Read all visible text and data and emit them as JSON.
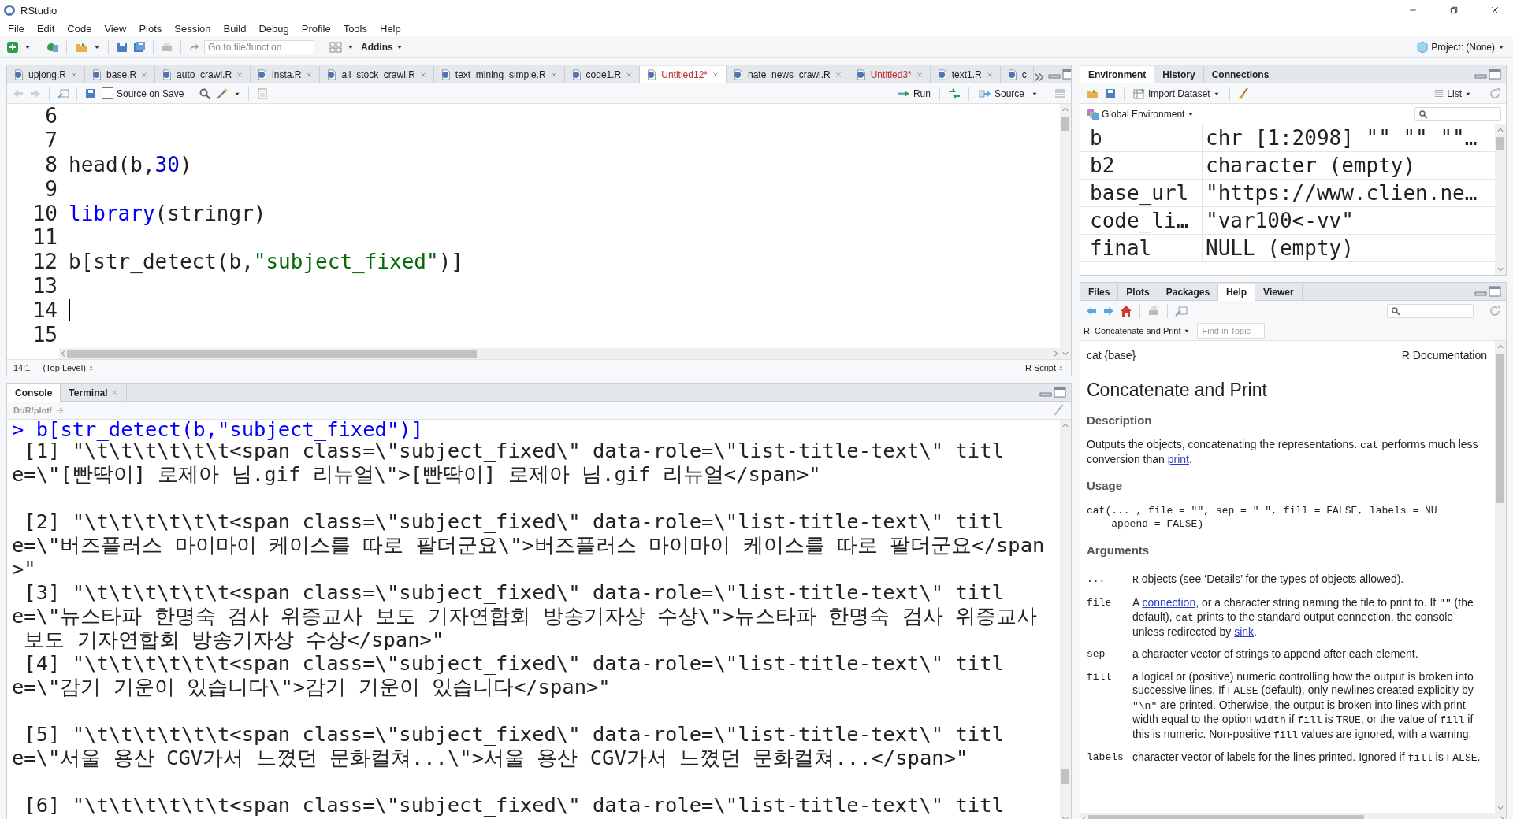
{
  "window": {
    "title": "RStudio"
  },
  "menu": [
    "File",
    "Edit",
    "Code",
    "View",
    "Plots",
    "Session",
    "Build",
    "Debug",
    "Profile",
    "Tools",
    "Help"
  ],
  "toolbar": {
    "goto_placeholder": "Go to file/function",
    "addins": "Addins",
    "project": "Project: (None)"
  },
  "editor": {
    "tabs": [
      {
        "label": "upjong.R",
        "selected": false,
        "modified": false
      },
      {
        "label": "base.R",
        "selected": false,
        "modified": false
      },
      {
        "label": "auto_crawl.R",
        "selected": false,
        "modified": false
      },
      {
        "label": "insta.R",
        "selected": false,
        "modified": false
      },
      {
        "label": "all_stock_crawl.R",
        "selected": false,
        "modified": false
      },
      {
        "label": "text_mining_simple.R",
        "selected": false,
        "modified": false
      },
      {
        "label": "code1.R",
        "selected": false,
        "modified": false
      },
      {
        "label": "Untitled12*",
        "selected": true,
        "modified": true
      },
      {
        "label": "nate_news_crawl.R",
        "selected": false,
        "modified": false
      },
      {
        "label": "Untitled3*",
        "selected": false,
        "modified": true
      },
      {
        "label": "text1.R",
        "selected": false,
        "modified": false
      },
      {
        "label": "c",
        "selected": false,
        "modified": false
      }
    ],
    "source_on_save": {
      "label": "Source on Save",
      "checked": false
    },
    "run": "Run",
    "source": "Source",
    "lines": [
      {
        "number": "6",
        "cursor": false
      },
      {
        "number": "7",
        "cursor": false
      },
      {
        "number": "8",
        "cursor": false,
        "tokens": [
          {
            "text": "head(b,",
            "kind": "plain"
          },
          {
            "text": "30",
            "kind": "number"
          },
          {
            "text": ")",
            "kind": "plain"
          }
        ]
      },
      {
        "number": "9",
        "cursor": false
      },
      {
        "number": "10",
        "cursor": false,
        "tokens": [
          {
            "text": "library",
            "kind": "keyword"
          },
          {
            "text": "(stringr)",
            "kind": "plain"
          }
        ]
      },
      {
        "number": "11",
        "cursor": false
      },
      {
        "number": "12",
        "cursor": false,
        "tokens": [
          {
            "text": "b[str_detect(b,",
            "kind": "plain"
          },
          {
            "text": "\"subject_fixed\"",
            "kind": "string"
          },
          {
            "text": ")]",
            "kind": "plain"
          }
        ]
      },
      {
        "number": "13",
        "cursor": false
      },
      {
        "number": "14",
        "cursor": true
      },
      {
        "number": "15",
        "cursor": false
      }
    ],
    "status": {
      "position": "14:1",
      "scope": "(Top Level)",
      "file_type": "R Script"
    }
  },
  "console": {
    "tabs": [
      {
        "label": "Console",
        "selected": true,
        "closable": false
      },
      {
        "label": "Terminal",
        "selected": false,
        "closable": true
      }
    ],
    "path": "D:/R/plot/",
    "command": "> b[str_detect(b,\"subject_fixed\")]",
    "output": [
      {
        "text": " [1] \"\\t\\t\\t\\t\\t\\t<span class=\\\"subject_fixed\\\" data-role=\\\"list-title-text\\\" titl",
        "space_before": false
      },
      {
        "text": "e=\\\"[빤딱이] 로제아 님.gif 리뉴얼\\\">[빤딱이] 로제아 님.gif 리뉴얼</span>\"",
        "space_before": false
      },
      {
        "text": " [2] \"\\t\\t\\t\\t\\t\\t<span class=\\\"subject_fixed\\\" data-role=\\\"list-title-text\\\" titl",
        "space_before": true
      },
      {
        "text": "e=\\\"버즈플러스 마이마이 케이스를 따로 팔더군요\\\">버즈플러스 마이마이 케이스를 따로 팔더군요</span",
        "space_before": false
      },
      {
        "text": ">\"",
        "space_before": false
      },
      {
        "text": " [3] \"\\t\\t\\t\\t\\t\\t<span class=\\\"subject_fixed\\\" data-role=\\\"list-title-text\\\" titl",
        "space_before": false
      },
      {
        "text": "e=\\\"뉴스타파 한명숙 검사 위증교사 보도 기자연합회 방송기자상 수상\\\">뉴스타파 한명숙 검사 위증교사",
        "space_before": false
      },
      {
        "text": " 보도 기자연합회 방송기자상 수상</span>\"",
        "space_before": false
      },
      {
        "text": " [4] \"\\t\\t\\t\\t\\t\\t<span class=\\\"subject_fixed\\\" data-role=\\\"list-title-text\\\" titl",
        "space_before": false
      },
      {
        "text": "e=\\\"감기 기운이 있습니다\\\">감기 기운이 있습니다</span>\"",
        "space_before": false
      },
      {
        "text": " [5] \"\\t\\t\\t\\t\\t\\t<span class=\\\"subject_fixed\\\" data-role=\\\"list-title-text\\\" titl",
        "space_before": true
      },
      {
        "text": "e=\\\"서울 용산 CGV가서 느꼈던 문화컬쳐...\\\">서울 용산 CGV가서 느꼈던 문화컬쳐...</span>\"",
        "space_before": false
      },
      {
        "text": " [6] \"\\t\\t\\t\\t\\t\\t<span class=\\\"subject_fixed\\\" data-role=\\\"list-title-text\\\" titl",
        "space_before": true
      }
    ]
  },
  "environment": {
    "tabs": [
      {
        "label": "Environment",
        "selected": true
      },
      {
        "label": "History",
        "selected": false
      },
      {
        "label": "Connections",
        "selected": false
      }
    ],
    "import": "Import Dataset",
    "view": "List",
    "scope": "Global Environment",
    "rows": [
      {
        "name": "b",
        "value": "chr [1:2098] \"\" \"\" \"\"…"
      },
      {
        "name": "b2",
        "value": "character (empty)"
      },
      {
        "name": "base_url",
        "value": "\"https://www.clien.ne…"
      },
      {
        "name": "code_li…",
        "value": "\"var100<-vv\""
      },
      {
        "name": "final",
        "value": "NULL (empty)"
      }
    ]
  },
  "help_pane": {
    "tabs": [
      {
        "label": "Files",
        "selected": false
      },
      {
        "label": "Plots",
        "selected": false
      },
      {
        "label": "Packages",
        "selected": false
      },
      {
        "label": "Help",
        "selected": true
      },
      {
        "label": "Viewer",
        "selected": false
      }
    ],
    "topic": "R: Concatenate and Print",
    "find_placeholder": "Find in Topic",
    "doc": {
      "package": "cat {base}",
      "source": "R Documentation",
      "title": "Concatenate and Print",
      "sections": [
        {
          "heading": "Description",
          "kind": "paragraph",
          "segments": [
            {
              "kind": "text",
              "text": "Outputs the objects, concatenating the representations. "
            },
            {
              "kind": "code",
              "text": "cat"
            },
            {
              "kind": "text",
              "text": " performs much less conversion than "
            },
            {
              "kind": "link",
              "text": "print"
            },
            {
              "kind": "text",
              "text": "."
            }
          ]
        },
        {
          "heading": "Usage",
          "kind": "code",
          "lines": [
            "cat(... , file = \"\", sep = \" \", fill = FALSE, labels = NU",
            "    append = FALSE)"
          ]
        },
        {
          "heading": "Arguments",
          "kind": "arguments",
          "arguments": [
            {
              "name": "...",
              "segments": [
                {
                  "kind": "code",
                  "text": "R"
                },
                {
                  "kind": "text",
                  "text": " objects (see ‘Details’ for the types of objects allowed)."
                }
              ]
            },
            {
              "name": "file",
              "segments": [
                {
                  "kind": "text",
                  "text": "A "
                },
                {
                  "kind": "link",
                  "text": "connection"
                },
                {
                  "kind": "text",
                  "text": ", or a character string naming the file to print to. If "
                },
                {
                  "kind": "code",
                  "text": "\"\""
                },
                {
                  "kind": "text",
                  "text": " (the default), "
                },
                {
                  "kind": "code",
                  "text": "cat"
                },
                {
                  "kind": "text",
                  "text": " prints to the standard output connection, the console unless redirected by "
                },
                {
                  "kind": "link",
                  "text": "sink"
                },
                {
                  "kind": "text",
                  "text": "."
                }
              ]
            },
            {
              "name": "sep",
              "segments": [
                {
                  "kind": "text",
                  "text": "a character vector of strings to append after each element."
                }
              ]
            },
            {
              "name": "fill",
              "segments": [
                {
                  "kind": "text",
                  "text": "a logical or (positive) numeric controlling how the output is broken into successive lines. If "
                },
                {
                  "kind": "code",
                  "text": "FALSE"
                },
                {
                  "kind": "text",
                  "text": " (default), only newlines created explicitly by "
                },
                {
                  "kind": "code",
                  "text": "\"\\n\""
                },
                {
                  "kind": "text",
                  "text": " are printed. Otherwise, the output is broken into lines with print width equal to the option "
                },
                {
                  "kind": "code",
                  "text": "width"
                },
                {
                  "kind": "text",
                  "text": " if "
                },
                {
                  "kind": "code",
                  "text": "fill"
                },
                {
                  "kind": "text",
                  "text": " is "
                },
                {
                  "kind": "code",
                  "text": "TRUE"
                },
                {
                  "kind": "text",
                  "text": ", or the value of "
                },
                {
                  "kind": "code",
                  "text": "fill"
                },
                {
                  "kind": "text",
                  "text": " if this is numeric. Non-positive "
                },
                {
                  "kind": "code",
                  "text": "fill"
                },
                {
                  "kind": "text",
                  "text": " values are ignored, with a warning."
                }
              ]
            },
            {
              "name": "labels",
              "segments": [
                {
                  "kind": "text",
                  "text": "character vector of labels for the lines printed. Ignored if "
                },
                {
                  "kind": "code",
                  "text": "fill"
                },
                {
                  "kind": "text",
                  "text": " is "
                },
                {
                  "kind": "code",
                  "text": "FALSE"
                },
                {
                  "kind": "text",
                  "text": "."
                }
              ]
            }
          ]
        }
      ]
    }
  }
}
